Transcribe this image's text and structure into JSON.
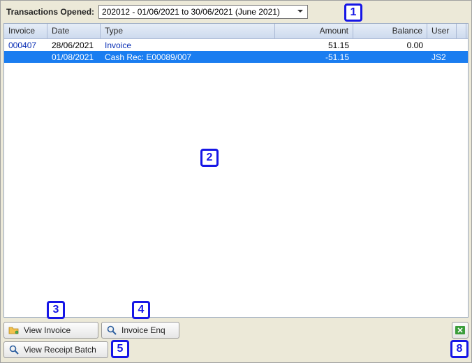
{
  "filter": {
    "label": "Transactions Opened:",
    "selected": "202012 - 01/06/2021 to 30/06/2021 (June 2021)"
  },
  "grid": {
    "headers": {
      "invoice": "Invoice",
      "date": "Date",
      "type": "Type",
      "amount": "Amount",
      "balance": "Balance",
      "user": "User"
    },
    "rows": [
      {
        "invoice": "000407",
        "date": "28/06/2021",
        "type": "Invoice",
        "amount": "51.15",
        "balance": "0.00",
        "user": "",
        "selected": false
      },
      {
        "invoice": "",
        "date": "01/08/2021",
        "type": "Cash Rec: E00089/007",
        "amount": "-51.15",
        "balance": "",
        "user": "JS2",
        "selected": true
      }
    ]
  },
  "buttons": {
    "view_invoice": "View Invoice",
    "invoice_enq": "Invoice Enq",
    "view_receipt_batch": "View Receipt Batch"
  },
  "callouts": {
    "c1": "1",
    "c2": "2",
    "c3": "3",
    "c4": "4",
    "c5": "5",
    "c8": "8"
  }
}
